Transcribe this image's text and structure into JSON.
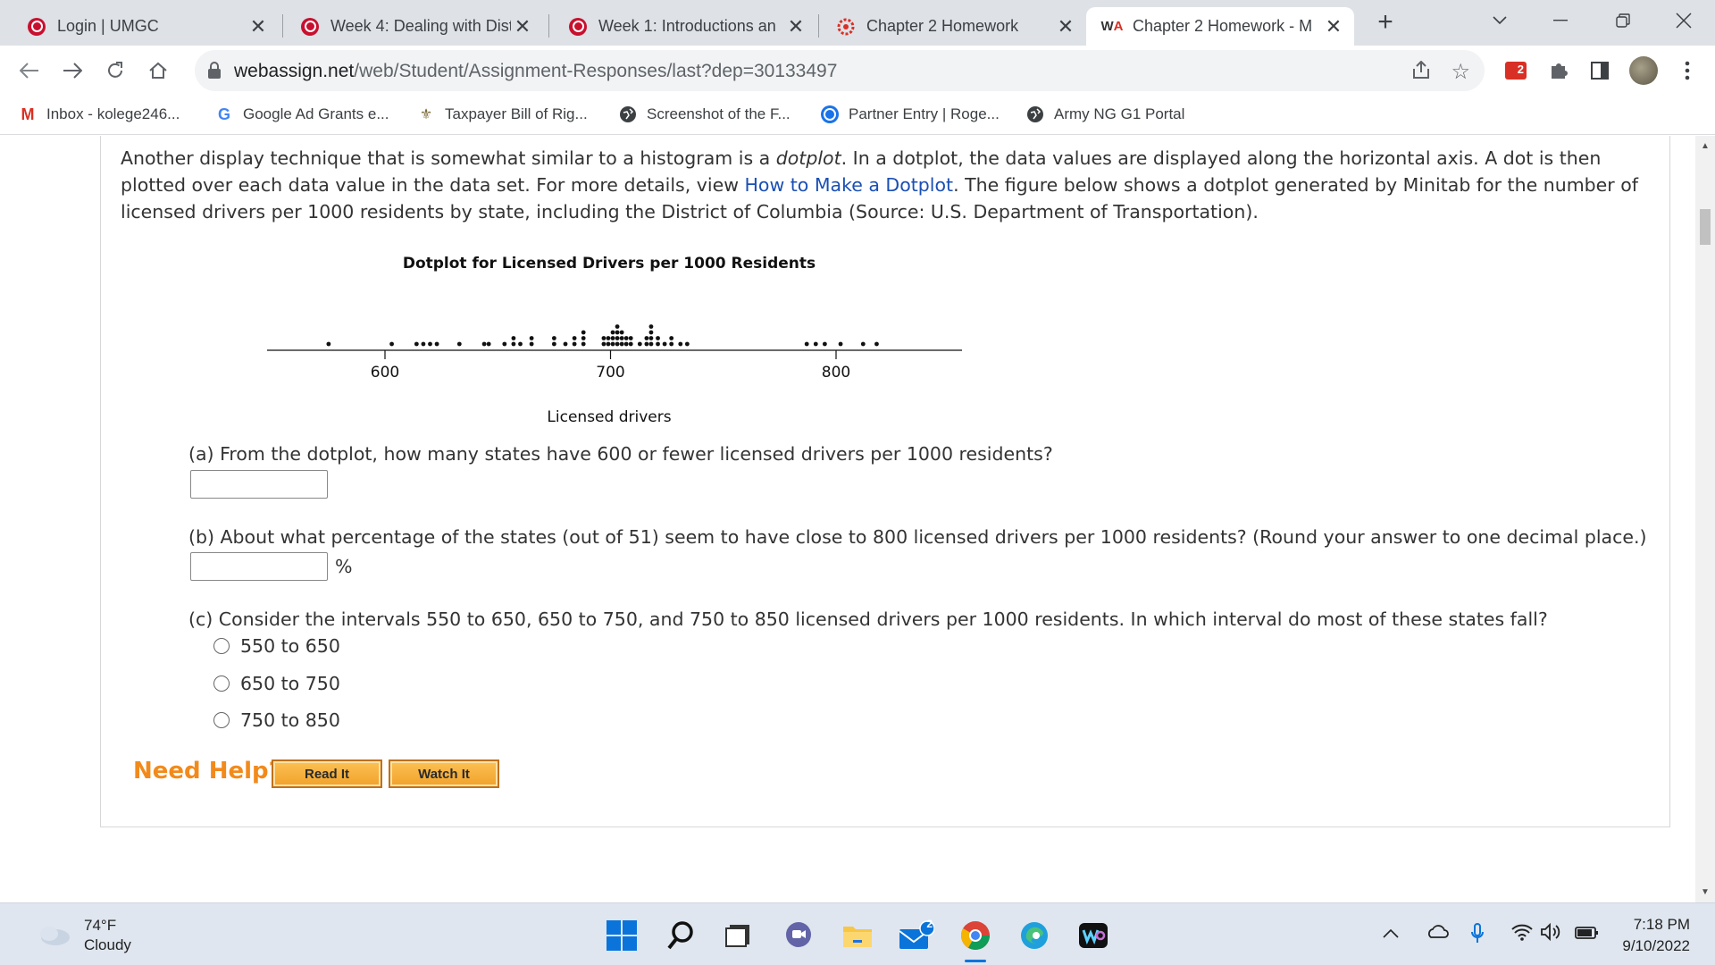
{
  "browser": {
    "tabs": [
      {
        "title": "Login | UMGC"
      },
      {
        "title": "Week 4: Dealing with Dist"
      },
      {
        "title": "Week 1: Introductions an"
      },
      {
        "title": "Chapter 2 Homework"
      },
      {
        "title": "Chapter 2 Homework - M"
      }
    ],
    "url_host": "webassign.net",
    "url_path": "/web/Student/Assignment-Responses/last?dep=30133497",
    "extension_badge": "2",
    "bookmarks": [
      {
        "label": "Inbox - kolege246..."
      },
      {
        "label": "Google Ad Grants e..."
      },
      {
        "label": "Taxpayer Bill of Rig..."
      },
      {
        "label": "Screenshot of the F..."
      },
      {
        "label": "Partner Entry | Roge..."
      },
      {
        "label": "Army NG G1 Portal"
      }
    ]
  },
  "question": {
    "intro_1": "Another display technique that is somewhat similar to a histogram is a ",
    "intro_em": "dotplot",
    "intro_2": ". In a dotplot, the data values are displayed along the horizontal axis. A dot is then plotted over each data value in the data set. For more details, view ",
    "intro_link": "How to Make a Dotplot",
    "intro_3": ". The figure below shows a dotplot generated by Minitab for the number of licensed drivers per 1000 residents by state, including the District of Columbia (Source: U.S. Department of Transportation).",
    "part_a": "(a) From the dotplot, how many states have 600 or fewer licensed drivers per 1000 residents?",
    "part_b": "(b) About what percentage of the states (out of 51) seem to have close to 800 licensed drivers per 1000 residents? (Round your answer to one decimal place.)",
    "part_b_unit": "%",
    "part_c": "(c) Consider the intervals 550 to 650, 650 to 750, and 750 to 850 licensed drivers per 1000 residents. In which interval do most of these states fall?",
    "options": [
      "550 to 650",
      "650 to 750",
      "750 to 850"
    ],
    "need_help": "Need Help?",
    "read_it": "Read It",
    "watch_it": "Watch It"
  },
  "chart_data": {
    "type": "scatter",
    "title": "Dotplot for Licensed Drivers per 1000 Residents",
    "xlabel": "Licensed drivers",
    "ylabel": "",
    "xticks": [
      600,
      700,
      800
    ],
    "xlim": [
      570,
      827
    ],
    "grid": false,
    "stacks": [
      {
        "x": 575,
        "count": 1
      },
      {
        "x": 603,
        "count": 1
      },
      {
        "x": 614,
        "count": 1
      },
      {
        "x": 617,
        "count": 1
      },
      {
        "x": 620,
        "count": 1
      },
      {
        "x": 623,
        "count": 1
      },
      {
        "x": 633,
        "count": 1
      },
      {
        "x": 644,
        "count": 1
      },
      {
        "x": 646,
        "count": 1
      },
      {
        "x": 653,
        "count": 1
      },
      {
        "x": 657,
        "count": 2
      },
      {
        "x": 660,
        "count": 1
      },
      {
        "x": 665,
        "count": 2
      },
      {
        "x": 675,
        "count": 2
      },
      {
        "x": 680,
        "count": 1
      },
      {
        "x": 684,
        "count": 2
      },
      {
        "x": 688,
        "count": 3
      },
      {
        "x": 697,
        "count": 2
      },
      {
        "x": 699,
        "count": 2
      },
      {
        "x": 701,
        "count": 3
      },
      {
        "x": 703,
        "count": 4
      },
      {
        "x": 705,
        "count": 3
      },
      {
        "x": 707,
        "count": 2
      },
      {
        "x": 709,
        "count": 2
      },
      {
        "x": 713,
        "count": 1
      },
      {
        "x": 716,
        "count": 2
      },
      {
        "x": 718,
        "count": 4
      },
      {
        "x": 721,
        "count": 2
      },
      {
        "x": 724,
        "count": 1
      },
      {
        "x": 727,
        "count": 2
      },
      {
        "x": 731,
        "count": 1
      },
      {
        "x": 734,
        "count": 1
      },
      {
        "x": 787,
        "count": 1
      },
      {
        "x": 791,
        "count": 1
      },
      {
        "x": 795,
        "count": 1
      },
      {
        "x": 802,
        "count": 1
      },
      {
        "x": 812,
        "count": 1
      },
      {
        "x": 818,
        "count": 1
      }
    ]
  },
  "taskbar": {
    "temperature": "74°F",
    "condition": "Cloudy",
    "mail_badge": "2",
    "time": "7:18 PM",
    "date": "9/10/2022"
  }
}
